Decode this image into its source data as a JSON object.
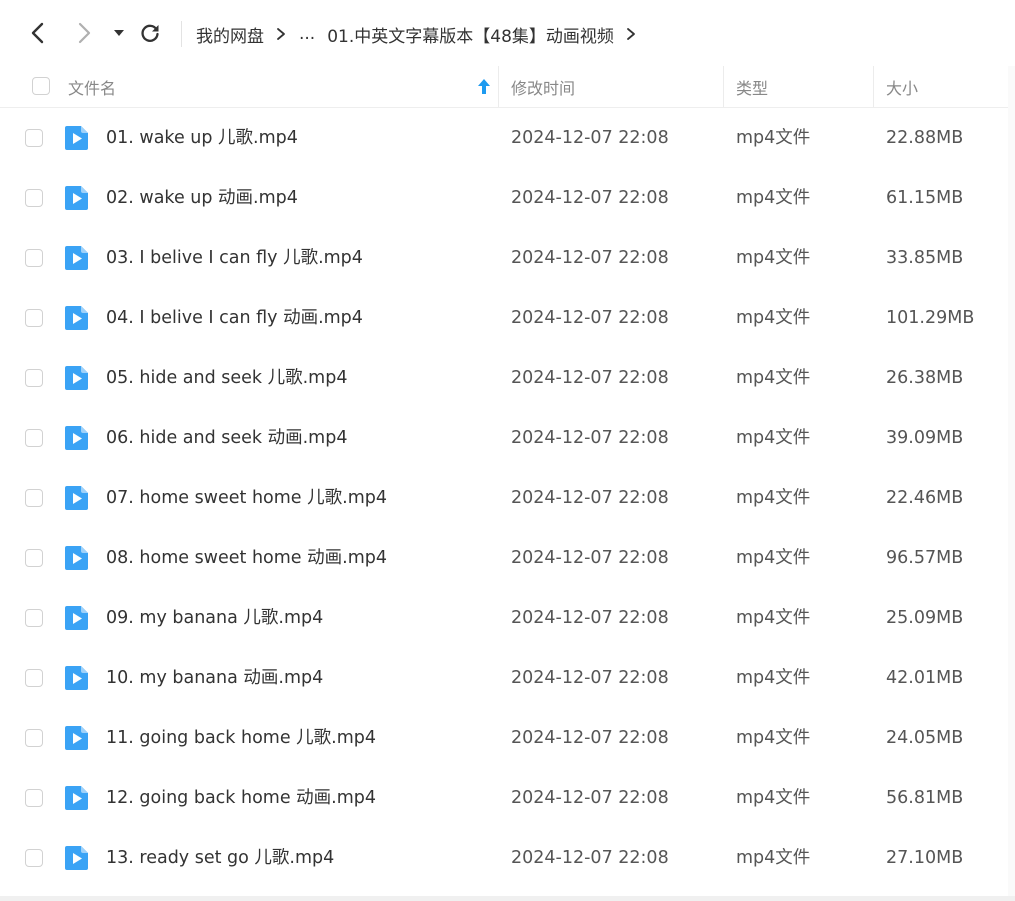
{
  "nav": {
    "back_icon": "chevron-left-icon",
    "forward_icon": "chevron-right-icon",
    "dropdown_icon": "caret-down-icon",
    "refresh_icon": "refresh-icon"
  },
  "breadcrumb": {
    "root": "我的网盘",
    "ellipsis": "...",
    "current": "01.中英文字幕版本【48集】动画视频"
  },
  "columns": {
    "name": "文件名",
    "modified": "修改时间",
    "type": "类型",
    "size": "大小",
    "sort_icon": "arrow-up-icon"
  },
  "colors": {
    "accent": "#1e9bf0",
    "file_icon": "#3aa3f5",
    "text": "#333333",
    "muted": "#888888"
  },
  "files": [
    {
      "name": "01. wake up 儿歌.mp4",
      "modified": "2024-12-07 22:08",
      "type": "mp4文件",
      "size": "22.88MB"
    },
    {
      "name": "02. wake up 动画.mp4",
      "modified": "2024-12-07 22:08",
      "type": "mp4文件",
      "size": "61.15MB"
    },
    {
      "name": "03. I belive I can fly 儿歌.mp4",
      "modified": "2024-12-07 22:08",
      "type": "mp4文件",
      "size": "33.85MB"
    },
    {
      "name": "04. I belive I can fly 动画.mp4",
      "modified": "2024-12-07 22:08",
      "type": "mp4文件",
      "size": "101.29MB"
    },
    {
      "name": "05. hide and seek 儿歌.mp4",
      "modified": "2024-12-07 22:08",
      "type": "mp4文件",
      "size": "26.38MB"
    },
    {
      "name": "06. hide and seek 动画.mp4",
      "modified": "2024-12-07 22:08",
      "type": "mp4文件",
      "size": "39.09MB"
    },
    {
      "name": "07. home sweet home 儿歌.mp4",
      "modified": "2024-12-07 22:08",
      "type": "mp4文件",
      "size": "22.46MB"
    },
    {
      "name": "08. home sweet home 动画.mp4",
      "modified": "2024-12-07 22:08",
      "type": "mp4文件",
      "size": "96.57MB"
    },
    {
      "name": "09. my banana 儿歌.mp4",
      "modified": "2024-12-07 22:08",
      "type": "mp4文件",
      "size": "25.09MB"
    },
    {
      "name": "10. my banana 动画.mp4",
      "modified": "2024-12-07 22:08",
      "type": "mp4文件",
      "size": "42.01MB"
    },
    {
      "name": "11. going back home 儿歌.mp4",
      "modified": "2024-12-07 22:08",
      "type": "mp4文件",
      "size": "24.05MB"
    },
    {
      "name": "12. going back home 动画.mp4",
      "modified": "2024-12-07 22:08",
      "type": "mp4文件",
      "size": "56.81MB"
    },
    {
      "name": "13. ready set go 儿歌.mp4",
      "modified": "2024-12-07 22:08",
      "type": "mp4文件",
      "size": "27.10MB"
    }
  ]
}
